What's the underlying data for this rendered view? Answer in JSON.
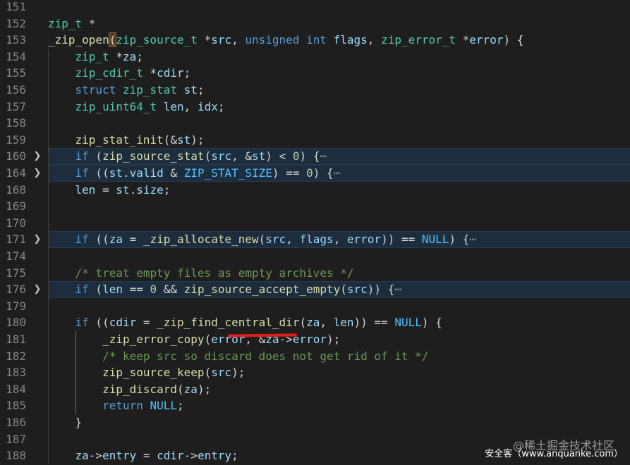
{
  "lines": [
    {
      "n": "151",
      "tokens": []
    },
    {
      "n": "152",
      "tokens": [
        [
          "ty",
          "zip_t"
        ],
        [
          "df",
          " *"
        ]
      ]
    },
    {
      "n": "153",
      "tokens": [
        [
          "fn",
          "_zip_open"
        ],
        [
          "brk",
          ""
        ],
        [
          "ty",
          "zip_source_t"
        ],
        [
          "df",
          " *"
        ],
        [
          "vr",
          "src"
        ],
        [
          "df",
          ", "
        ],
        [
          "kw",
          "unsigned"
        ],
        [
          "df",
          " "
        ],
        [
          "kw",
          "int"
        ],
        [
          "df",
          " "
        ],
        [
          "vr",
          "flags"
        ],
        [
          "df",
          ", "
        ],
        [
          "ty",
          "zip_error_t"
        ],
        [
          "df",
          " *"
        ],
        [
          "vr",
          "error"
        ],
        [
          "df",
          ") {"
        ]
      ]
    },
    {
      "n": "154",
      "tokens": [
        [
          "df",
          "    "
        ],
        [
          "ty",
          "zip_t"
        ],
        [
          "df",
          " *"
        ],
        [
          "vr",
          "za"
        ],
        [
          "df",
          ";"
        ]
      ]
    },
    {
      "n": "155",
      "tokens": [
        [
          "df",
          "    "
        ],
        [
          "ty",
          "zip_cdir_t"
        ],
        [
          "df",
          " *"
        ],
        [
          "vr",
          "cdir"
        ],
        [
          "df",
          ";"
        ]
      ]
    },
    {
      "n": "156",
      "tokens": [
        [
          "df",
          "    "
        ],
        [
          "kw",
          "struct"
        ],
        [
          "df",
          " "
        ],
        [
          "ty",
          "zip_stat"
        ],
        [
          "df",
          " "
        ],
        [
          "vr",
          "st"
        ],
        [
          "df",
          ";"
        ]
      ]
    },
    {
      "n": "157",
      "tokens": [
        [
          "df",
          "    "
        ],
        [
          "ty",
          "zip_uint64_t"
        ],
        [
          "df",
          " "
        ],
        [
          "vr",
          "len"
        ],
        [
          "df",
          ", "
        ],
        [
          "vr",
          "idx"
        ],
        [
          "df",
          ";"
        ]
      ]
    },
    {
      "n": "158",
      "tokens": []
    },
    {
      "n": "159",
      "tokens": [
        [
          "df",
          "    "
        ],
        [
          "fn",
          "zip_stat_init"
        ],
        [
          "df",
          "(&"
        ],
        [
          "vr",
          "st"
        ],
        [
          "df",
          ");"
        ]
      ]
    },
    {
      "n": "160",
      "fold": true,
      "hl": true,
      "tokens": [
        [
          "df",
          "    "
        ],
        [
          "kw",
          "if"
        ],
        [
          "df",
          " ("
        ],
        [
          "fn",
          "zip_source_stat"
        ],
        [
          "df",
          "("
        ],
        [
          "vr",
          "src"
        ],
        [
          "df",
          ", &"
        ],
        [
          "vr",
          "st"
        ],
        [
          "df",
          ") < "
        ],
        [
          "nm",
          "0"
        ],
        [
          "df",
          ") {"
        ],
        [
          "ell",
          "⋯"
        ]
      ]
    },
    {
      "n": "164",
      "fold": true,
      "hl": true,
      "tokens": [
        [
          "df",
          "    "
        ],
        [
          "kw",
          "if"
        ],
        [
          "df",
          " (("
        ],
        [
          "vr",
          "st"
        ],
        [
          "df",
          "."
        ],
        [
          "vr",
          "valid"
        ],
        [
          "df",
          " & "
        ],
        [
          "ct",
          "ZIP_STAT_SIZE"
        ],
        [
          "df",
          ") == "
        ],
        [
          "nm",
          "0"
        ],
        [
          "df",
          ") {"
        ],
        [
          "ell",
          "⋯"
        ]
      ]
    },
    {
      "n": "168",
      "tokens": [
        [
          "df",
          "    "
        ],
        [
          "vr",
          "len"
        ],
        [
          "df",
          " = "
        ],
        [
          "vr",
          "st"
        ],
        [
          "df",
          "."
        ],
        [
          "vr",
          "size"
        ],
        [
          "df",
          ";"
        ]
      ]
    },
    {
      "n": "169",
      "tokens": []
    },
    {
      "n": "170",
      "tokens": []
    },
    {
      "n": "171",
      "fold": true,
      "hl": true,
      "tokens": [
        [
          "df",
          "    "
        ],
        [
          "kw",
          "if"
        ],
        [
          "df",
          " (("
        ],
        [
          "vr",
          "za"
        ],
        [
          "df",
          " = "
        ],
        [
          "fn",
          "_zip_allocate_new"
        ],
        [
          "df",
          "("
        ],
        [
          "vr",
          "src"
        ],
        [
          "df",
          ", "
        ],
        [
          "vr",
          "flags"
        ],
        [
          "df",
          ", "
        ],
        [
          "vr",
          "error"
        ],
        [
          "df",
          ")) == "
        ],
        [
          "ct",
          "NULL"
        ],
        [
          "df",
          ") {"
        ],
        [
          "ell",
          "⋯"
        ]
      ]
    },
    {
      "n": "174",
      "tokens": []
    },
    {
      "n": "175",
      "tokens": [
        [
          "df",
          "    "
        ],
        [
          "cm",
          "/* treat empty files as empty archives */"
        ]
      ]
    },
    {
      "n": "176",
      "fold": true,
      "hl": true,
      "tokens": [
        [
          "df",
          "    "
        ],
        [
          "kw",
          "if"
        ],
        [
          "df",
          " ("
        ],
        [
          "vr",
          "len"
        ],
        [
          "df",
          " == "
        ],
        [
          "nm",
          "0"
        ],
        [
          "df",
          " && "
        ],
        [
          "fn",
          "zip_source_accept_empty"
        ],
        [
          "df",
          "("
        ],
        [
          "vr",
          "src"
        ],
        [
          "df",
          ")) {"
        ],
        [
          "ell",
          "⋯"
        ]
      ]
    },
    {
      "n": "179",
      "tokens": []
    },
    {
      "n": "180",
      "tokens": [
        [
          "df",
          "    "
        ],
        [
          "kw",
          "if"
        ],
        [
          "df",
          " (("
        ],
        [
          "vr",
          "cdir"
        ],
        [
          "df",
          " = "
        ],
        [
          "fn",
          "_zip_find_central_dir"
        ],
        [
          "df",
          "("
        ],
        [
          "vr",
          "za"
        ],
        [
          "df",
          ", "
        ],
        [
          "vr",
          "len"
        ],
        [
          "df",
          ")) == "
        ],
        [
          "ct",
          "NULL"
        ],
        [
          "df",
          ") {"
        ]
      ]
    },
    {
      "n": "181",
      "tokens": [
        [
          "df",
          "        "
        ],
        [
          "fn",
          "_zip_error_copy"
        ],
        [
          "df",
          "("
        ],
        [
          "vr",
          "error"
        ],
        [
          "df",
          ", &"
        ],
        [
          "vr",
          "za"
        ],
        [
          "df",
          "->"
        ],
        [
          "vr",
          "error"
        ],
        [
          "df",
          ");"
        ]
      ]
    },
    {
      "n": "182",
      "tokens": [
        [
          "df",
          "        "
        ],
        [
          "cm",
          "/* keep src so discard does not get rid of it */"
        ]
      ]
    },
    {
      "n": "183",
      "tokens": [
        [
          "df",
          "        "
        ],
        [
          "fn",
          "zip_source_keep"
        ],
        [
          "df",
          "("
        ],
        [
          "vr",
          "src"
        ],
        [
          "df",
          ");"
        ]
      ]
    },
    {
      "n": "184",
      "tokens": [
        [
          "df",
          "        "
        ],
        [
          "fn",
          "zip_discard"
        ],
        [
          "df",
          "("
        ],
        [
          "vr",
          "za"
        ],
        [
          "df",
          ");"
        ]
      ]
    },
    {
      "n": "185",
      "tokens": [
        [
          "df",
          "        "
        ],
        [
          "kw",
          "return"
        ],
        [
          "df",
          " "
        ],
        [
          "ct",
          "NULL"
        ],
        [
          "df",
          ";"
        ]
      ]
    },
    {
      "n": "186",
      "tokens": [
        [
          "df",
          "    }"
        ]
      ]
    },
    {
      "n": "187",
      "tokens": []
    },
    {
      "n": "188",
      "tokens": [
        [
          "df",
          "    "
        ],
        [
          "vr",
          "za"
        ],
        [
          "df",
          "->"
        ],
        [
          "vr",
          "entry"
        ],
        [
          "df",
          " = "
        ],
        [
          "vr",
          "cdir"
        ],
        [
          "df",
          "->"
        ],
        [
          "vr",
          "entry"
        ],
        [
          "df",
          ";"
        ]
      ]
    }
  ],
  "watermark": {
    "line1": "@稀土掘金技术社区",
    "line2": "安全客（www.anquanke.com）"
  }
}
